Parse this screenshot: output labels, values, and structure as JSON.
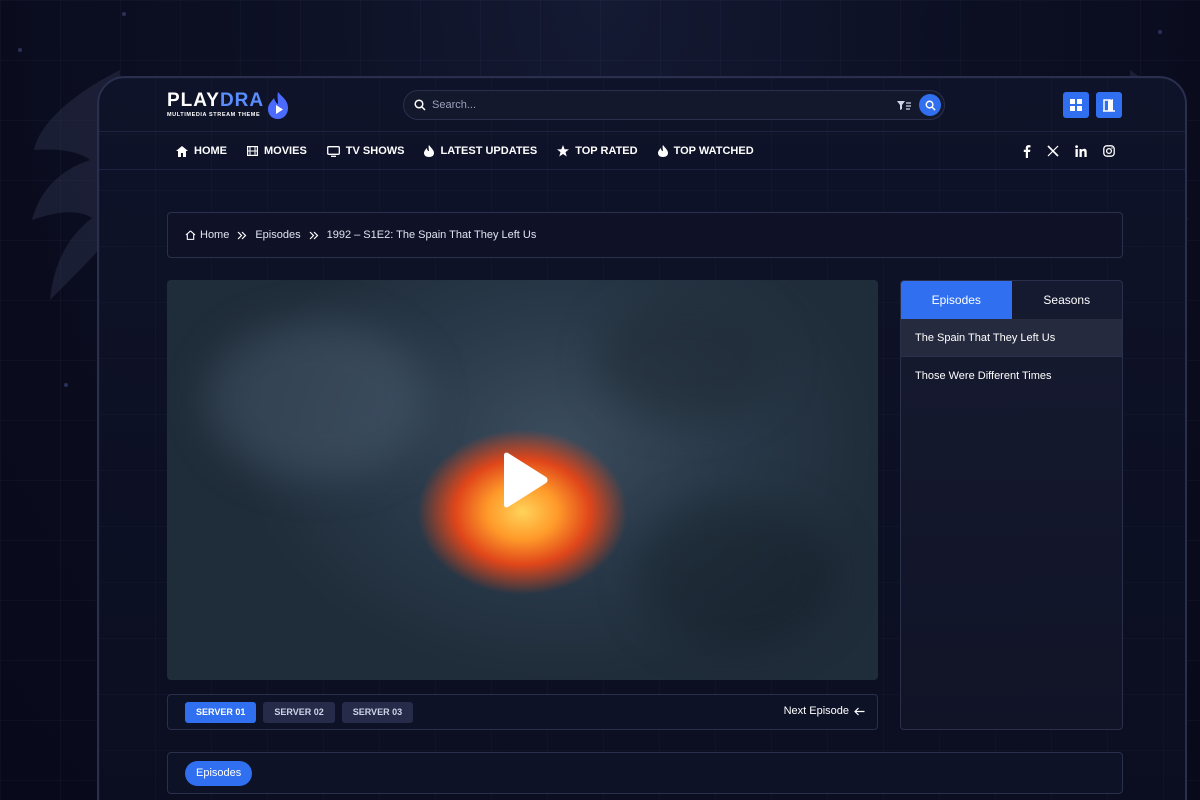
{
  "logo": {
    "name_part1": "PLAY",
    "name_part2": "DRA",
    "tagline": "MULTIMEDIA STREAM THEME"
  },
  "search": {
    "placeholder": "Search..."
  },
  "nav": {
    "items": [
      {
        "label": "HOME",
        "icon": "home-icon"
      },
      {
        "label": "MOVIES",
        "icon": "film-icon"
      },
      {
        "label": "TV SHOWS",
        "icon": "tv-icon"
      },
      {
        "label": "LATEST UPDATES",
        "icon": "fire-icon"
      },
      {
        "label": "TOP RATED",
        "icon": "star-icon"
      },
      {
        "label": "TOP WATCHED",
        "icon": "fire-icon"
      }
    ],
    "socials": [
      "facebook-icon",
      "x-icon",
      "linkedin-icon",
      "instagram-icon"
    ]
  },
  "breadcrumb": {
    "home": "Home",
    "section": "Episodes",
    "current": "1992 – S1E2: The Spain That They Left Us"
  },
  "servers": {
    "items": [
      "SERVER 01",
      "SERVER 02",
      "SERVER 03"
    ],
    "active_index": 0,
    "next_label": "Next Episode"
  },
  "episodes_panel": {
    "tabs": [
      "Episodes",
      "Seasons"
    ],
    "active_tab": 0,
    "items": [
      "The Spain That They Left Us",
      "Those Were Different Times"
    ],
    "active_item": 0
  },
  "bottom": {
    "pill": "Episodes"
  },
  "colors": {
    "accent": "#2f6ff0",
    "background": "#0c0f22",
    "border": "#2a2f4c"
  }
}
